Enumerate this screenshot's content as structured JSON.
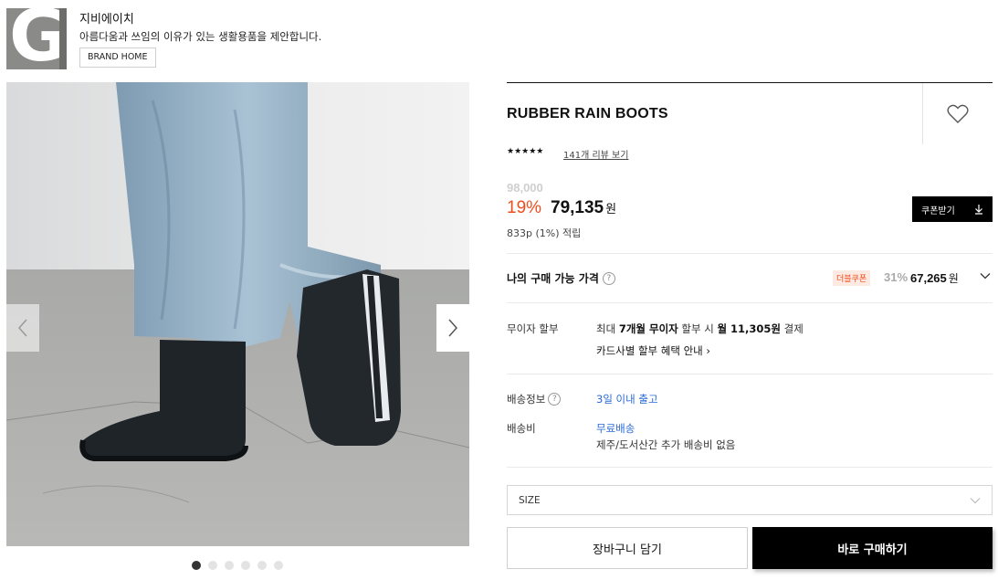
{
  "brand": {
    "logo_letter": "G",
    "name": "지비에이치",
    "description": "아름다움과 쓰임의 이유가 있는 생활용품을 제안합니다.",
    "home_button": "BRAND HOME"
  },
  "gallery": {
    "dot_count": 6,
    "active_index": 0,
    "prev_icon": "chevron-left-icon",
    "next_icon": "chevron-right-icon"
  },
  "product": {
    "title": "RUBBER RAIN BOOTS",
    "rating_stars": "★★★★★",
    "rating_value": 5,
    "reviews_link": "141개 리뷰 보기",
    "original_price": "98,000",
    "discount": "19%",
    "price": "79,135",
    "price_unit": "원",
    "points": "833p (1%) 적립",
    "coupon_button": "쿠폰받기",
    "wishlist_icon": "heart-icon"
  },
  "my_price": {
    "label": "나의 구매 가능 가격",
    "help": "?",
    "badge": "더블쿠폰",
    "percent": "31%",
    "amount": "67,265",
    "unit": "원"
  },
  "installment": {
    "label": "무이자 할부",
    "line1_pre": "최대 ",
    "line1_b1": "7개월 무이자",
    "line1_mid": " 할부 시 ",
    "line1_b2": "월 11,305원",
    "line1_post": " 결제",
    "line2": "카드사별 할부 혜택 안내 ›"
  },
  "shipping": {
    "info_label": "배송정보",
    "info_value": "3일 이내 출고",
    "fee_label": "배송비",
    "fee_value": "무료배송",
    "fee_note": "제주/도서산간 추가 배송비 없음"
  },
  "size_select": {
    "placeholder": "SIZE"
  },
  "actions": {
    "cart": "장바구니 담기",
    "buy": "바로 구매하기"
  },
  "colors": {
    "accent": "#f04d1d",
    "link_blue": "#2a6bd6",
    "primary_button": "#000000"
  }
}
